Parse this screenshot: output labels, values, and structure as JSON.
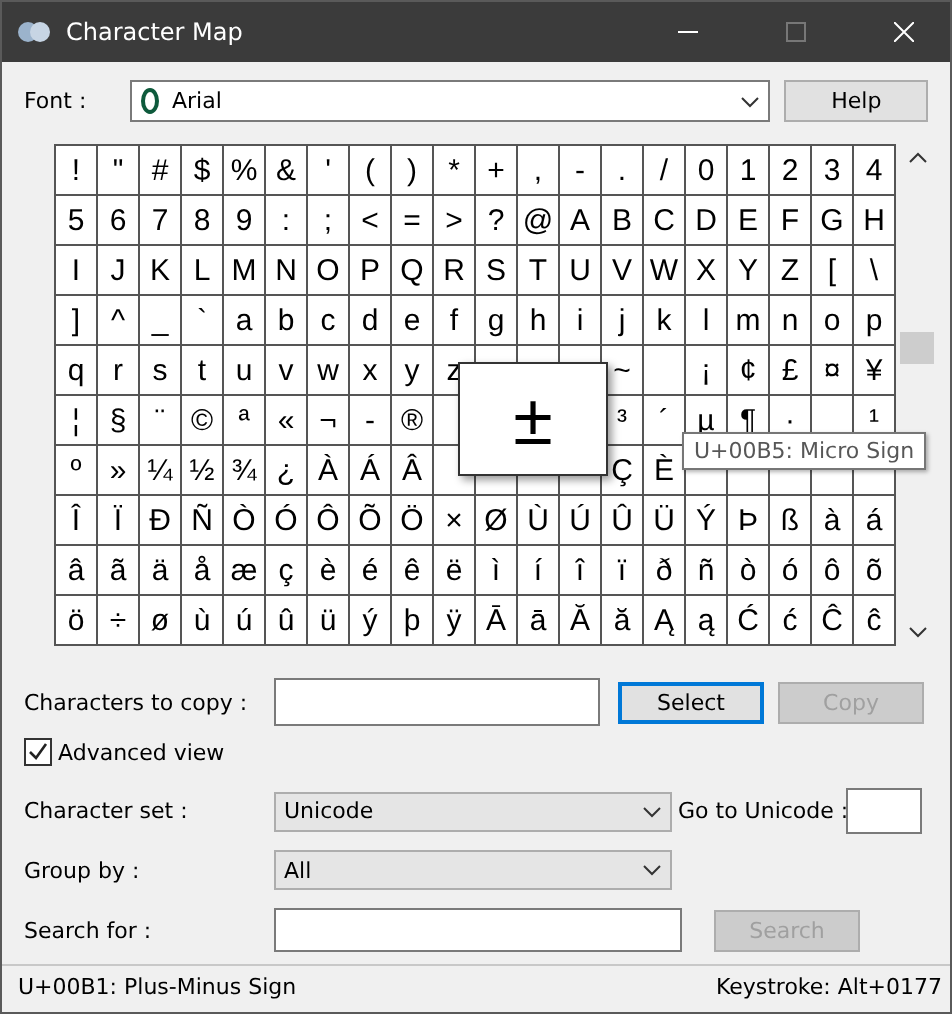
{
  "window": {
    "title": "Character Map"
  },
  "font": {
    "label": "Font :",
    "value": "Arial"
  },
  "help_button": "Help",
  "grid": {
    "rows": [
      [
        "!",
        "\"",
        "#",
        "$",
        "%",
        "&",
        "'",
        "(",
        ")",
        "*",
        "+",
        ",",
        "-",
        ".",
        "/",
        "0",
        "1",
        "2",
        "3",
        "4"
      ],
      [
        "5",
        "6",
        "7",
        "8",
        "9",
        ":",
        ";",
        "<",
        "=",
        ">",
        "?",
        "@",
        "A",
        "B",
        "C",
        "D",
        "E",
        "F",
        "G",
        "H"
      ],
      [
        "I",
        "J",
        "K",
        "L",
        "M",
        "N",
        "O",
        "P",
        "Q",
        "R",
        "S",
        "T",
        "U",
        "V",
        "W",
        "X",
        "Y",
        "Z",
        "[",
        "\\"
      ],
      [
        "]",
        "^",
        "_",
        "`",
        "a",
        "b",
        "c",
        "d",
        "e",
        "f",
        "g",
        "h",
        "i",
        "j",
        "k",
        "l",
        "m",
        "n",
        "o",
        "p"
      ],
      [
        "q",
        "r",
        "s",
        "t",
        "u",
        "v",
        "w",
        "x",
        "y",
        "z",
        null,
        null,
        null,
        "~",
        null,
        "¡",
        "¢",
        "£",
        "¤",
        "¥"
      ],
      [
        "¦",
        "§",
        "¨",
        "©",
        "ª",
        "«",
        "¬",
        "-",
        "®",
        null,
        null,
        null,
        null,
        "³",
        "´",
        "µ",
        "¶",
        "·",
        null,
        "¹"
      ],
      [
        "º",
        "»",
        "¼",
        "½",
        "¾",
        "¿",
        "À",
        "Á",
        "Â",
        null,
        null,
        null,
        null,
        "Ç",
        "È",
        null,
        null,
        null,
        null,
        null
      ],
      [
        "Î",
        "Ï",
        "Ð",
        "Ñ",
        "Ò",
        "Ó",
        "Ô",
        "Õ",
        "Ö",
        "×",
        "Ø",
        "Ù",
        "Ú",
        "Û",
        "Ü",
        "Ý",
        "Þ",
        "ß",
        "à",
        "á"
      ],
      [
        "â",
        "ã",
        "ä",
        "å",
        "æ",
        "ç",
        "è",
        "é",
        "ê",
        "ë",
        "ì",
        "í",
        "î",
        "ï",
        "ð",
        "ñ",
        "ò",
        "ó",
        "ô",
        "õ"
      ],
      [
        "ö",
        "÷",
        "ø",
        "ù",
        "ú",
        "û",
        "ü",
        "ý",
        "þ",
        "ÿ",
        "Ā",
        "ā",
        "Ă",
        "ă",
        "Ą",
        "ą",
        "Ć",
        "ć",
        "Ĉ",
        "ĉ"
      ]
    ],
    "magnified": "±",
    "tooltip": "U+00B5: Micro Sign"
  },
  "copy_row": {
    "label": "Characters to copy :",
    "select_button": {
      "label": "Select",
      "focused": true
    },
    "copy_button": {
      "label": "Copy",
      "disabled": true
    }
  },
  "advanced_view": {
    "label": "Advanced view",
    "checked": true
  },
  "character_set": {
    "label": "Character set :",
    "value": "Unicode"
  },
  "go_to_unicode": {
    "label": "Go to Unicode :"
  },
  "group_by": {
    "label": "Group by :",
    "value": "All"
  },
  "search": {
    "label": "Search for :",
    "button": {
      "label": "Search",
      "disabled": true
    }
  },
  "status_bar": {
    "character": "U+00B1: Plus-Minus Sign",
    "keystroke": "Keystroke: Alt+0177"
  }
}
